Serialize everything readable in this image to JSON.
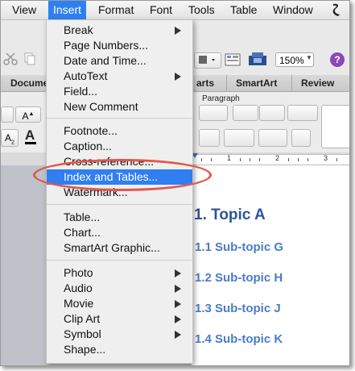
{
  "menubar": {
    "items": [
      "View",
      "Insert",
      "Format",
      "Font",
      "Tools",
      "Table",
      "Window"
    ],
    "active": "Insert"
  },
  "toolbar": {
    "zoom": "150%",
    "help": "?"
  },
  "ribbon": {
    "tabs": [
      "Docume",
      "arts",
      "SmartArt",
      "Review"
    ],
    "group_label": "Paragraph"
  },
  "insert_menu": {
    "group1": [
      "Break",
      "Page Numbers...",
      "Date and Time...",
      "AutoText",
      "Field...",
      "New Comment"
    ],
    "group2": [
      "Footnote...",
      "Caption...",
      "Cross-reference...",
      "Index and Tables...",
      "Watermark..."
    ],
    "group3": [
      "Table...",
      "Chart...",
      "SmartArt Graphic..."
    ],
    "group4": [
      "Photo",
      "Audio",
      "Movie",
      "Clip Art",
      "Symbol",
      "Shape..."
    ],
    "highlighted": "Index and Tables..."
  },
  "document": {
    "heading": "1. Topic A",
    "subtopics": [
      "1.1 Sub-topic G",
      "1.2 Sub-topic H",
      "1.3 Sub-topic J",
      "1.4 Sub-topic K"
    ]
  },
  "ruler": {
    "numbers": [
      "1",
      "2",
      "3"
    ]
  },
  "colors": {
    "highlight": "#2f7ff0",
    "annotation": "#e3574a",
    "heading": "#2f5597",
    "subheading": "#4a7cc7"
  }
}
